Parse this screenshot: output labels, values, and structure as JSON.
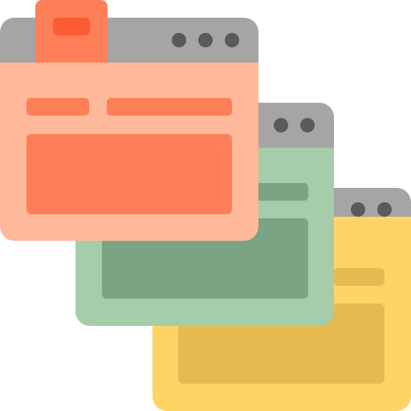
{
  "icon": {
    "name": "stacked-browser-windows-icon",
    "windows": [
      {
        "id": "back-window",
        "color_titlebar": "#A5A5A5",
        "color_body": "#FFD464",
        "color_content": "#E6BA50",
        "dots": 2
      },
      {
        "id": "middle-window",
        "color_titlebar": "#A5A5A5",
        "color_body": "#A5CDA9",
        "color_content": "#7CA384",
        "dots": 2
      },
      {
        "id": "front-window",
        "color_titlebar": "#A5A5A5",
        "color_body": "#FDB99A",
        "color_content": "#FE7E57",
        "color_tab": "#FE7E57",
        "color_tab_inner": "#FD5B33",
        "dots": 3
      }
    ],
    "dot_color": "#5A5A5A"
  }
}
